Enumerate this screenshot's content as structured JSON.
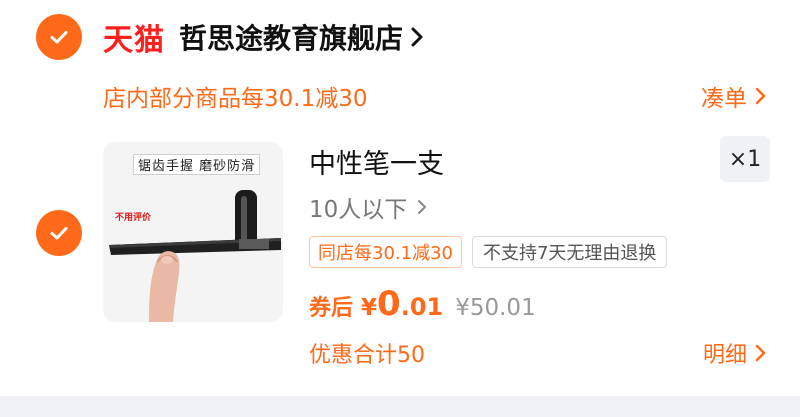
{
  "colors": {
    "accent": "#ff6a1a",
    "tmall_red": "#ff1f1f"
  },
  "shop": {
    "brand": "天猫",
    "name": "哲思途教育旗舰店",
    "select_icon": "checkmark-circle-icon",
    "chevron_icon": "chevron-right-icon"
  },
  "promo": {
    "text": "店内部分商品每30.1减30",
    "action_label": "凑单"
  },
  "item": {
    "image": {
      "caption": "锯齿手握 磨砂防滑",
      "tag": "不用评价"
    },
    "title": "中性笔一支",
    "quantity": "×1",
    "spec": "10人以下",
    "tags": [
      "同店每30.1减30",
      "不支持7天无理由退换"
    ],
    "price_label": "券后",
    "currency": "¥",
    "price_integer": "0",
    "price_decimal": ".01",
    "original_price": "¥50.01",
    "discount_total": "优惠合计50",
    "detail_label": "明细"
  }
}
